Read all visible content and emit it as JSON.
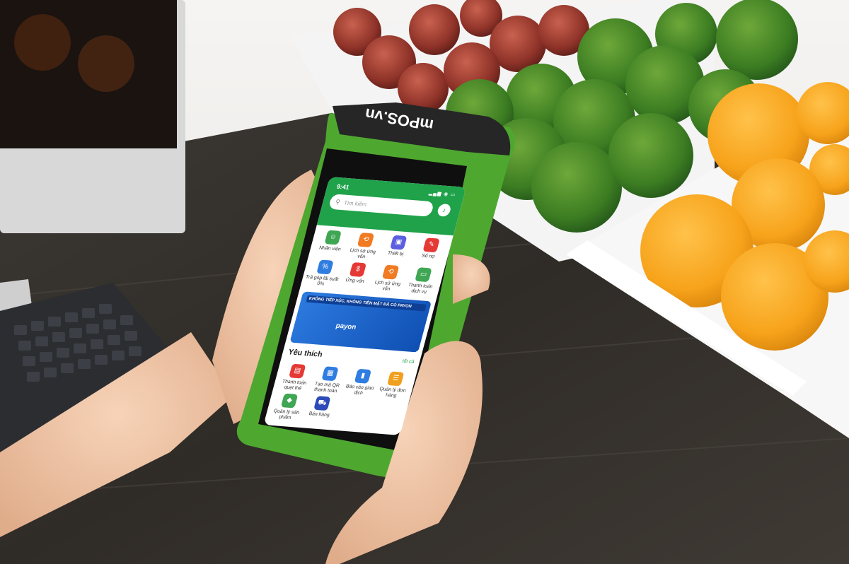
{
  "status_bar": {
    "time": "9:41",
    "icons": "▂▄▆ ◉ ▭"
  },
  "search": {
    "placeholder": "Tìm kiếm",
    "icon": "search-icon"
  },
  "bell": {
    "icon": "bell-icon"
  },
  "grid": [
    {
      "label": "Nhân viên",
      "icon": "user-icon",
      "color": "#3fa653"
    },
    {
      "label": "Lịch sử ứng vốn",
      "icon": "history-icon",
      "color": "#f07b22"
    },
    {
      "label": "Thiết bị",
      "icon": "device-icon",
      "color": "#5b5fe0"
    },
    {
      "label": "Sổ nợ",
      "icon": "ledger-icon",
      "color": "#e53935"
    },
    {
      "label": "Trả góp lãi suất 0%",
      "icon": "percent-icon",
      "color": "#2f7de0"
    },
    {
      "label": "Ứng vốn",
      "icon": "money-icon",
      "color": "#e53935"
    },
    {
      "label": "Lịch sử ứng vốn",
      "icon": "history-icon",
      "color": "#f07b22"
    },
    {
      "label": "Thanh toán dịch vụ",
      "icon": "card-icon",
      "color": "#3fa653"
    }
  ],
  "banner": {
    "title": "KHÔNG TIẾP XÚC, KHÔNG TIỀN MẶT ĐÃ CÓ PAYON",
    "brand": "payon"
  },
  "favorites": {
    "title": "Yêu thích",
    "all": "tốt cả",
    "items": [
      {
        "label": "Thanh toán quẹt thẻ",
        "icon": "card-swipe-icon",
        "color": "#e53935"
      },
      {
        "label": "Tạo mã QR thanh toán",
        "icon": "qr-icon",
        "color": "#2f7de0"
      },
      {
        "label": "Báo cáo giao dịch",
        "icon": "chart-icon",
        "color": "#2f7de0"
      },
      {
        "label": "Quản lý đơn hàng",
        "icon": "order-icon",
        "color": "#f0a020"
      },
      {
        "label": "Quản lý sản phẩm",
        "icon": "product-icon",
        "color": "#3fa653"
      },
      {
        "label": "Bán hàng",
        "icon": "cart-icon",
        "color": "#2c4ab8"
      }
    ]
  },
  "device": {
    "brand": "mPOS.vn"
  }
}
